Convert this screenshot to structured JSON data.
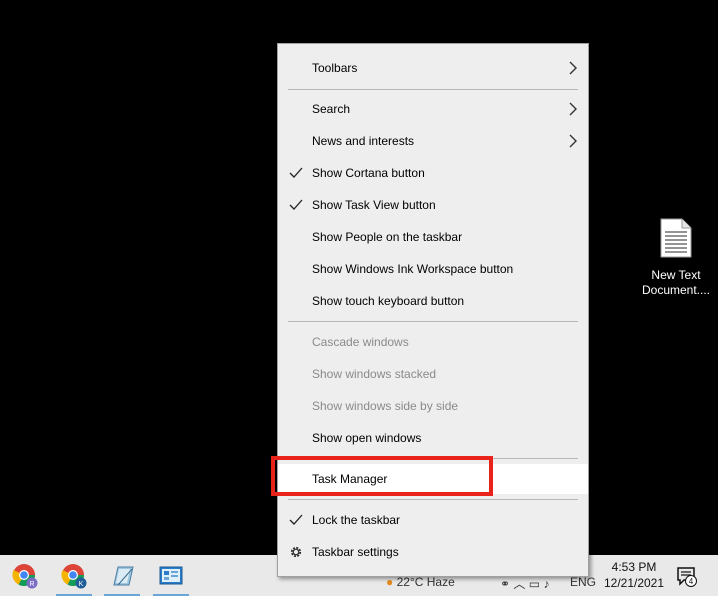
{
  "desktop": {
    "icon_label_line1": "New Text",
    "icon_label_line2": "Document...."
  },
  "menu": {
    "items": [
      {
        "label": "Toolbars",
        "submenu": true
      },
      {
        "label": "Search",
        "submenu": true
      },
      {
        "label": "News and interests",
        "submenu": true
      },
      {
        "label": "Show Cortana button",
        "checked": true
      },
      {
        "label": "Show Task View button",
        "checked": true
      },
      {
        "label": "Show People on the taskbar"
      },
      {
        "label": "Show Windows Ink Workspace button"
      },
      {
        "label": "Show touch keyboard button"
      },
      {
        "label": "Cascade windows",
        "disabled": true
      },
      {
        "label": "Show windows stacked",
        "disabled": true
      },
      {
        "label": "Show windows side by side",
        "disabled": true
      },
      {
        "label": "Show open windows"
      },
      {
        "label": "Task Manager",
        "highlighted": true
      },
      {
        "label": "Lock the taskbar",
        "checked": true
      },
      {
        "label": "Taskbar settings",
        "icon": "gear-icon"
      }
    ]
  },
  "taskbar": {
    "apps": [
      {
        "icon": "chrome-icon",
        "badge": "R"
      },
      {
        "icon": "chrome-icon",
        "badge": "K"
      },
      {
        "icon": "notepad-icon"
      },
      {
        "icon": "control-panel-icon"
      }
    ],
    "weather": "22°C Haze",
    "language": "ENG",
    "clock_time": "4:53 PM",
    "clock_date": "12/21/2021",
    "notification_count": "4"
  },
  "colors": {
    "highlight_border": "#e8231a",
    "menu_background": "#eeeeee",
    "taskbar_background": "#e9e9e9"
  }
}
